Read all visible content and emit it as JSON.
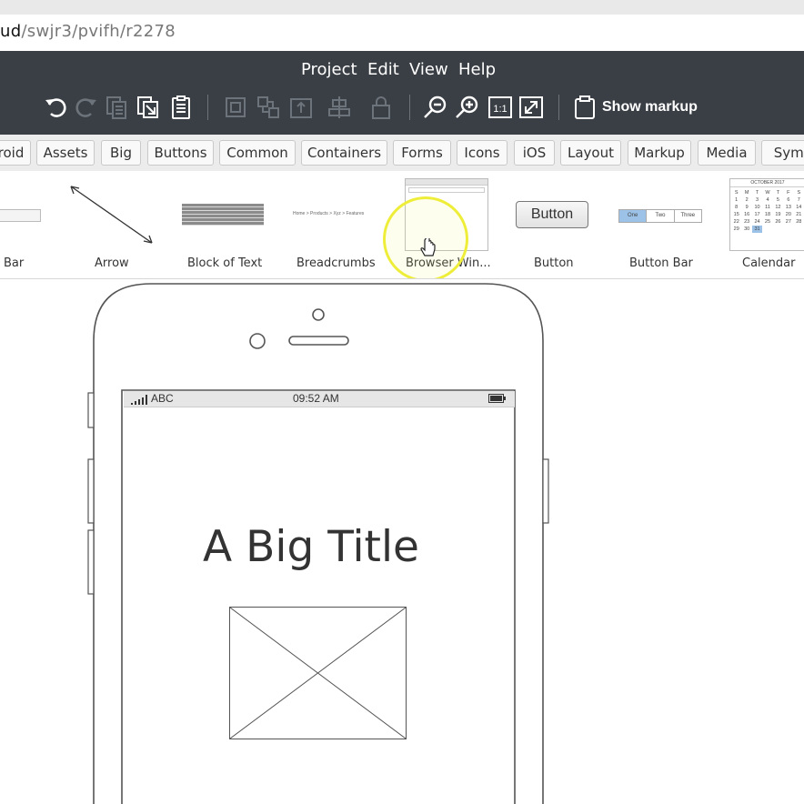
{
  "browser": {
    "url_bold": "ud",
    "url_rest": "/swjr3/pvifh/r2278"
  },
  "menu": [
    "Project",
    "Edit",
    "View",
    "Help"
  ],
  "toolbar": {
    "show_markup_label": "Show markup",
    "actual_size_label": "1:1"
  },
  "tabs": [
    "roid",
    "Assets",
    "Big",
    "Buttons",
    "Common",
    "Containers",
    "Forms",
    "Icons",
    "iOS",
    "Layout",
    "Markup",
    "Media",
    "Symb"
  ],
  "library": {
    "items": [
      "Bar",
      "Arrow",
      "Block of Text",
      "Breadcrumbs",
      "Browser Win...",
      "Button",
      "Button Bar",
      "Calendar"
    ],
    "button_preview_label": "Button",
    "button_bar_segments": [
      "One",
      "Two",
      "Three"
    ],
    "breadcrumb_preview": "Home > Products > Xyz > Features",
    "calendar_preview": {
      "month": "OCTOBER 2017",
      "weekdays": [
        "S",
        "M",
        "T",
        "W",
        "T",
        "F",
        "S"
      ],
      "days": [
        "1",
        "2",
        "3",
        "4",
        "5",
        "6",
        "7",
        "8",
        "9",
        "10",
        "11",
        "12",
        "13",
        "14",
        "15",
        "16",
        "17",
        "18",
        "19",
        "20",
        "21",
        "22",
        "23",
        "24",
        "25",
        "26",
        "27",
        "28",
        "29",
        "30",
        "31"
      ]
    }
  },
  "phone": {
    "carrier": "ABC",
    "time": "09:52 AM",
    "title": "A Big Title"
  },
  "colors": {
    "app_bar": "#3a3f45",
    "cursor_highlight": "#eeee3a"
  }
}
